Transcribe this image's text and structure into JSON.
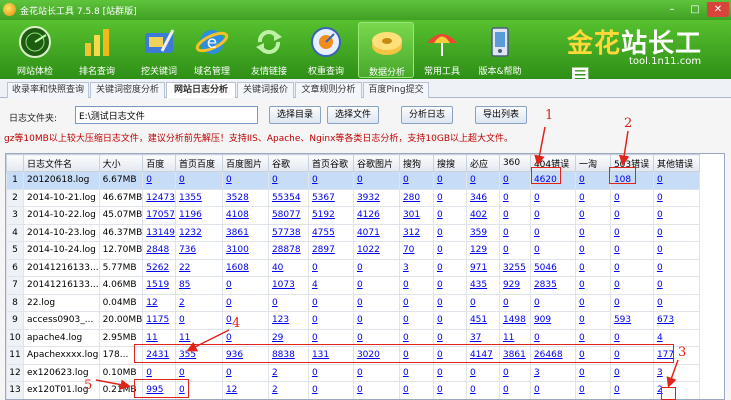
{
  "window": {
    "title": "金花站长工具 7.5.8 [站群版]",
    "min": "–",
    "max": "□",
    "close": "✕"
  },
  "toolbar": {
    "items": [
      {
        "label": "网站体检",
        "icon": "radar-icon"
      },
      {
        "label": "排名查询",
        "icon": "bar-chart-icon"
      },
      {
        "label": "挖关键词",
        "icon": "shovel-icon"
      },
      {
        "label": "域名管理",
        "icon": "ie-globe-icon"
      },
      {
        "label": "友情链接",
        "icon": "refresh-link-icon"
      },
      {
        "label": "权重查询",
        "icon": "gauge-icon"
      },
      {
        "label": "数据分析",
        "icon": "disk-icon"
      },
      {
        "label": "常用工具",
        "icon": "umbrella-icon"
      },
      {
        "label": "版本&帮助",
        "icon": "phone-help-icon"
      }
    ],
    "active_index": 6
  },
  "brand": {
    "cn_part1": "金花",
    "cn_part2": "站长工具",
    "url": "tool.1n11.com"
  },
  "tabs": [
    "收录率和快照查询",
    "关键词密度分析",
    "网站日志分析",
    "关键词报价",
    "文章规则分析",
    "百度Ping提交"
  ],
  "active_tab": 2,
  "panel": {
    "dir_label": "日志文件夹:",
    "dir_value": "E:\\测试日志文件",
    "btn_select_dir": "选择目录",
    "btn_select_file": "选择文件",
    "btn_analyze": "分析日志",
    "btn_export": "导出列表",
    "note": "gz等10MB以上较大压缩日志文件，建议分析前先解压！支持IIS、Apache、Nginx等各类日志分析，支持10GB以上超大文件。"
  },
  "table": {
    "columns": [
      "",
      "日志文件名",
      "大小",
      "百度",
      "首页百度",
      "百度图片",
      "谷歌",
      "首页谷歌",
      "谷歌图片",
      "搜狗",
      "搜搜",
      "必应",
      "360",
      "404错误",
      "一淘",
      "503错误",
      "其他错误"
    ],
    "rows": [
      [
        "1",
        "20120618.log",
        "6.67MB",
        "0",
        "0",
        "0",
        "0",
        "0",
        "0",
        "0",
        "0",
        "0",
        "0",
        "4620",
        "0",
        "108",
        "0"
      ],
      [
        "2",
        "2014-10-21.log",
        "46.67MB",
        "12473",
        "1355",
        "3528",
        "55354",
        "5367",
        "3932",
        "280",
        "0",
        "346",
        "0",
        "0",
        "0",
        "0",
        "0"
      ],
      [
        "3",
        "2014-10-22.log",
        "45.07MB",
        "17057",
        "1196",
        "4108",
        "58077",
        "5192",
        "4126",
        "301",
        "0",
        "402",
        "0",
        "0",
        "0",
        "0",
        "0"
      ],
      [
        "4",
        "2014-10-23.log",
        "46.37MB",
        "13149",
        "1232",
        "3861",
        "57738",
        "4755",
        "4071",
        "312",
        "0",
        "359",
        "0",
        "0",
        "0",
        "0",
        "0"
      ],
      [
        "5",
        "2014-10-24.log",
        "12.70MB",
        "2848",
        "736",
        "3100",
        "28878",
        "2897",
        "1022",
        "70",
        "0",
        "129",
        "0",
        "0",
        "0",
        "0",
        "0"
      ],
      [
        "6",
        "20141216133...",
        "5.77MB",
        "5262",
        "22",
        "1608",
        "40",
        "0",
        "0",
        "3",
        "0",
        "971",
        "3255",
        "5046",
        "0",
        "0",
        "0"
      ],
      [
        "7",
        "20141216133...",
        "4.06MB",
        "1519",
        "85",
        "0",
        "1073",
        "4",
        "0",
        "0",
        "0",
        "435",
        "929",
        "2835",
        "0",
        "0",
        "0"
      ],
      [
        "8",
        "22.log",
        "0.04MB",
        "12",
        "2",
        "0",
        "0",
        "0",
        "0",
        "0",
        "0",
        "0",
        "0",
        "0",
        "0",
        "0",
        "0"
      ],
      [
        "9",
        "access0903_...",
        "20.00MB",
        "1175",
        "0",
        "0",
        "123",
        "0",
        "0",
        "0",
        "0",
        "451",
        "1498",
        "909",
        "0",
        "593",
        "673"
      ],
      [
        "10",
        "apache4.log",
        "2.95MB",
        "11",
        "11",
        "0",
        "29",
        "0",
        "0",
        "0",
        "0",
        "37",
        "11",
        "0",
        "0",
        "0",
        "4"
      ],
      [
        "11",
        "Apachexxxx.log",
        "178...",
        "2431",
        "355",
        "936",
        "8838",
        "131",
        "3020",
        "0",
        "0",
        "4147",
        "3861",
        "26468",
        "0",
        "0",
        "177"
      ],
      [
        "12",
        "ex120623.log",
        "0.10MB",
        "0",
        "0",
        "0",
        "2",
        "0",
        "0",
        "0",
        "0",
        "0",
        "0",
        "3",
        "0",
        "0",
        "3"
      ],
      [
        "13",
        "ex120T01.log",
        "0.21MB",
        "995",
        "0",
        "12",
        "2",
        "0",
        "0",
        "0",
        "0",
        "0",
        "0",
        "0",
        "0",
        "0",
        "2"
      ]
    ],
    "selected_row": 0
  },
  "annotations": [
    "1",
    "2",
    "3",
    "4",
    "5"
  ],
  "colors": {
    "accent_green": "#3f9f23",
    "annotation_red": "#e2231a",
    "link_blue": "#0000ee",
    "note_red": "#c00000"
  }
}
